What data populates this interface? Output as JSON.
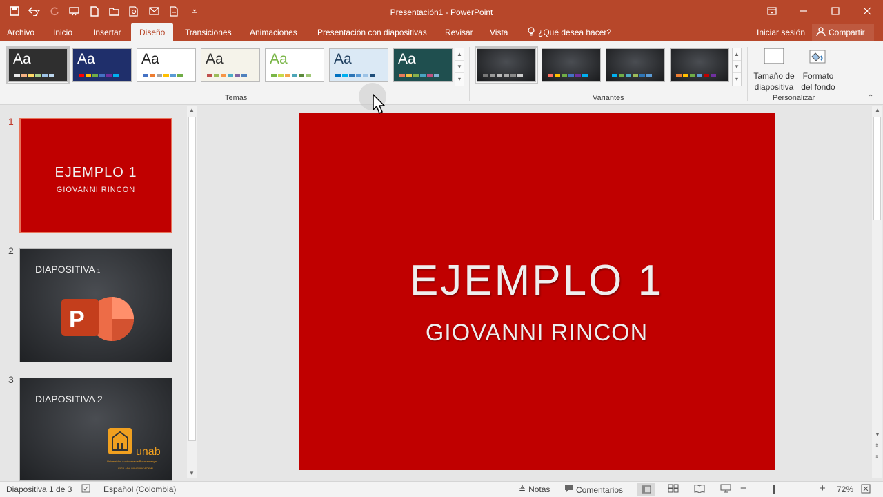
{
  "window": {
    "title": "Presentación1 - PowerPoint"
  },
  "qat": {
    "icons": [
      "save-icon",
      "undo-icon",
      "redo-icon",
      "start-from-beginning-icon",
      "new-icon",
      "open-icon",
      "print-preview-icon",
      "email-icon",
      "touch-mode-icon",
      "customize-qat-icon"
    ]
  },
  "tabs": [
    {
      "label": "Archivo"
    },
    {
      "label": "Inicio"
    },
    {
      "label": "Insertar"
    },
    {
      "label": "Diseño",
      "active": true
    },
    {
      "label": "Transiciones"
    },
    {
      "label": "Animaciones"
    },
    {
      "label": "Presentación con diapositivas"
    },
    {
      "label": "Revisar"
    },
    {
      "label": "Vista"
    }
  ],
  "tellme": "¿Qué desea hacer?",
  "signin": "Iniciar sesión",
  "share": "Compartir",
  "ribbon": {
    "themes_label": "Temas",
    "variants_label": "Variantes",
    "customize_label": "Personalizar",
    "themes": [
      {
        "aa": "Aa",
        "bg": "#2f2f2f",
        "fg": "#ffffff",
        "sw": [
          "#e8e8e8",
          "#f4b183",
          "#ffd966",
          "#a9d18e",
          "#9dc3e6",
          "#bdd7ee"
        ]
      },
      {
        "aa": "Aa",
        "bg": "#1f2f6b",
        "fg": "#ffffff",
        "sw": [
          "#ff0000",
          "#ffc000",
          "#70ad47",
          "#4472c4",
          "#7030a0",
          "#00b0f0"
        ]
      },
      {
        "aa": "Aa",
        "bg": "#ffffff",
        "fg": "#222222",
        "sw": [
          "#4472c4",
          "#ed7d31",
          "#a5a5a5",
          "#ffc000",
          "#5b9bd5",
          "#70ad47"
        ]
      },
      {
        "aa": "Aa",
        "bg": "#f5f3ea",
        "fg": "#333333",
        "sw": [
          "#c0504d",
          "#9bbb59",
          "#f79646",
          "#4bacc6",
          "#8064a2",
          "#4f81bd"
        ]
      },
      {
        "aa": "Aa",
        "bg": "#ffffff",
        "fg": "#7ab648",
        "sw": [
          "#7ab648",
          "#c8d94c",
          "#f3a64b",
          "#4da6b8",
          "#5c8a3d",
          "#a0c878"
        ]
      },
      {
        "aa": "Aa",
        "bg": "#dbe9f5",
        "fg": "#1f3f5f",
        "sw": [
          "#0070c0",
          "#00b0f0",
          "#2e75b6",
          "#5b9bd5",
          "#9dc3e6",
          "#1f4e79"
        ]
      },
      {
        "aa": "Aa",
        "bg": "#1f4f4f",
        "fg": "#ffffff",
        "sw": [
          "#e87a5a",
          "#f0c040",
          "#88b04b",
          "#4aa3c0",
          "#c05080",
          "#7fb3d5"
        ]
      }
    ],
    "variants": [
      {
        "sw": [
          "#777777",
          "#999999",
          "#bbbbbb",
          "#aaaaaa",
          "#888888",
          "#cccccc"
        ]
      },
      {
        "sw": [
          "#ff6f61",
          "#ffc000",
          "#70ad47",
          "#4472c4",
          "#7030a0",
          "#00b0f0"
        ]
      },
      {
        "sw": [
          "#00b0f0",
          "#70ad47",
          "#4bacc6",
          "#9bbb59",
          "#2e75b6",
          "#5b9bd5"
        ]
      },
      {
        "sw": [
          "#ed7d31",
          "#ffc000",
          "#70ad47",
          "#5b9bd5",
          "#c00000",
          "#7030a0"
        ]
      }
    ],
    "slide_size": "Tamaño de diapositiva",
    "format_bg": "Formato del fondo"
  },
  "slides": [
    {
      "num": "1",
      "title": "EJEMPLO 1",
      "subtitle": "GIOVANNI RINCON"
    },
    {
      "num": "2",
      "title": "DIAPOSITIVA",
      "title_suffix": "1"
    },
    {
      "num": "3",
      "title": "DIAPOSITIVA 2",
      "logo": "unab",
      "logo_small": "Universidad Autónoma de Bucaramanga",
      "logo_small2": "VIGILADA MINEDUCACIÓN"
    }
  ],
  "main_slide": {
    "title": "EJEMPLO 1",
    "subtitle": "GIOVANNI RINCON"
  },
  "status": {
    "slide_count": "Diapositiva 1 de 3",
    "language": "Español (Colombia)",
    "notes": "Notas",
    "comments": "Comentarios",
    "zoom": "72%"
  }
}
